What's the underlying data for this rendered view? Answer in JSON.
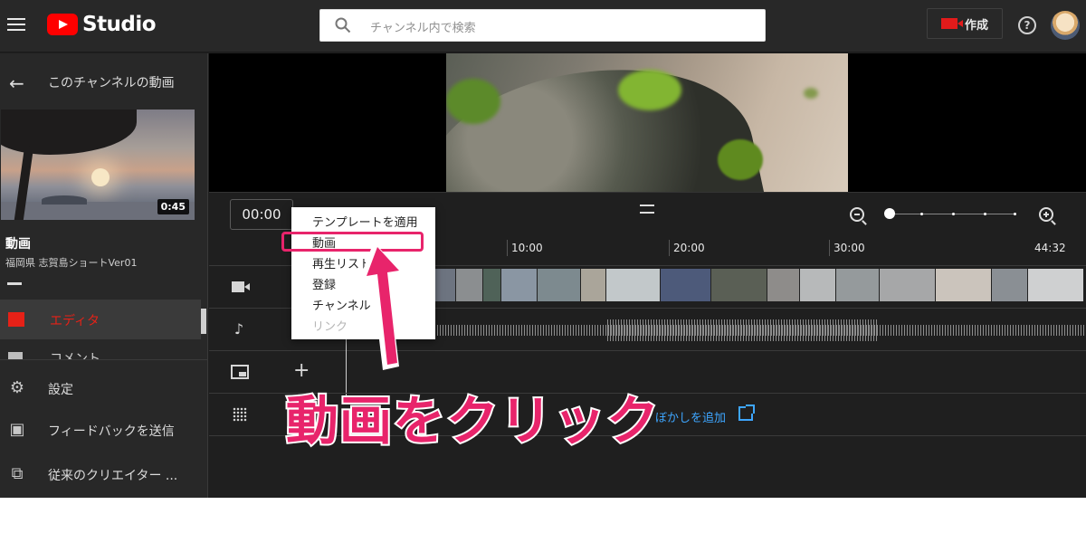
{
  "header": {
    "logo_text": "Studio",
    "search_placeholder": "チャンネル内で検索",
    "create_label": "作成",
    "help_label": "?"
  },
  "sidebar": {
    "back_label": "このチャンネルの動画",
    "video_duration": "0:45",
    "video_title": "動画",
    "video_subtitle": "福岡県 志賀島ショートVer01",
    "active_item": "エディタ",
    "cut_item": "コメント",
    "bottom_items": [
      {
        "label": "設定",
        "icon": "gear-icon"
      },
      {
        "label": "フィードバックを送信",
        "icon": "feedback-icon"
      },
      {
        "label": "従来のクリエイター ...",
        "icon": "classic-studio-icon"
      }
    ]
  },
  "timeline": {
    "timecode": "00:00",
    "ruler_labels": [
      "10:00",
      "20:00",
      "30:00",
      "44:32"
    ],
    "blur_link": "ぼかしを追加",
    "zoom_level": 0
  },
  "menu": {
    "items": [
      {
        "label": "テンプレートを適用",
        "disabled": false
      },
      {
        "label": "動画",
        "disabled": false,
        "highlighted": true
      },
      {
        "label": "再生リスト",
        "disabled": false
      },
      {
        "label": "登録",
        "disabled": false
      },
      {
        "label": "チャンネル",
        "disabled": false
      },
      {
        "label": "リンク",
        "disabled": true
      }
    ]
  },
  "annotation": {
    "callout": "動画をクリック",
    "color": "#e8246b"
  },
  "colors": {
    "accent_red": "#ff0000",
    "link_blue": "#3ea6ff",
    "annotation_pink": "#e8246b",
    "active_red": "#e62117"
  }
}
